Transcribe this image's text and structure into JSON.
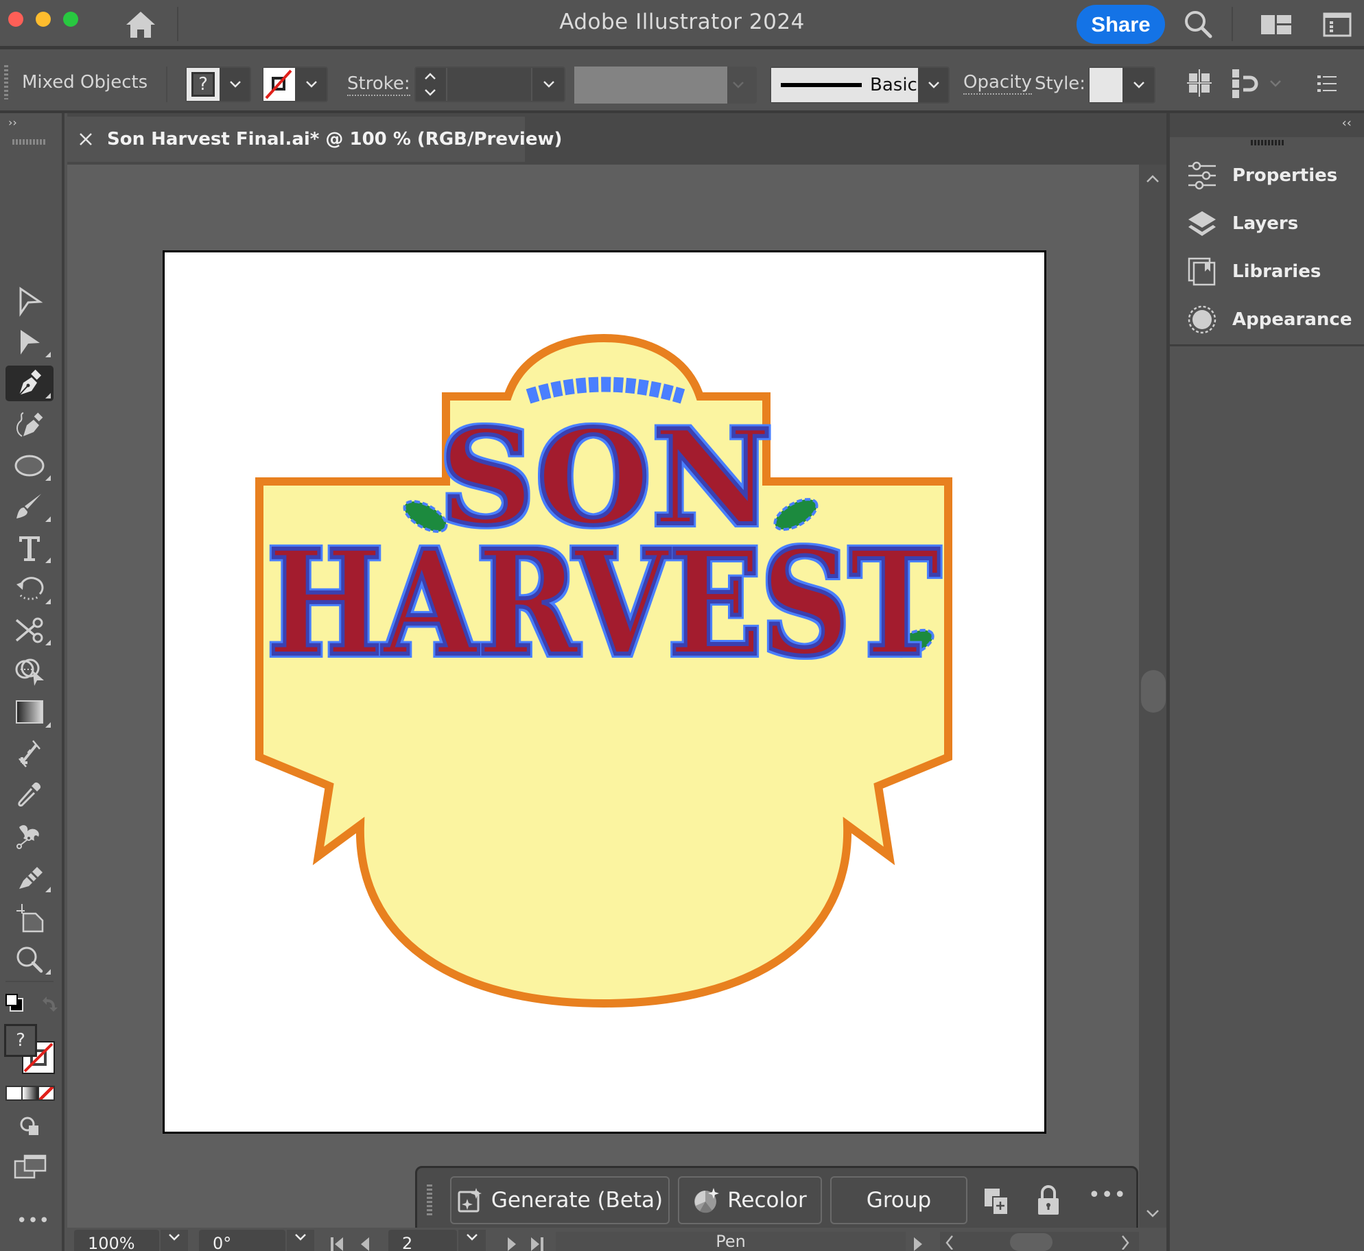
{
  "window": {
    "app_title": "Adobe Illustrator 2024",
    "share_label": "Share",
    "traffic_colors": {
      "close": "#fe5f57",
      "minimize": "#febc2e",
      "maximize": "#28c840"
    }
  },
  "control_bar": {
    "selection_label": "Mixed Objects",
    "fill_state": "?",
    "stroke_label": "Stroke:",
    "stroke_weight": "",
    "brush_label": "Basic",
    "opacity_label": "Opacity",
    "style_label": "Style:"
  },
  "document": {
    "tab_title": "Son Harvest Final.ai* @ 100 % (RGB/Preview)",
    "artwork": {
      "title_line1": "SON",
      "title_line2": "HARVEST",
      "colors": {
        "badge_fill": "#fbf4a0",
        "badge_stroke": "#e8801f",
        "letter_fill": "#a31c2e",
        "letter_outline": "#3a3fb0",
        "leaf": "#1c8a3e",
        "selection": "#4a7fff"
      }
    }
  },
  "tools": [
    {
      "name": "selection-tool",
      "label": "Selection"
    },
    {
      "name": "direct-selection-tool",
      "label": "Direct Selection"
    },
    {
      "name": "pen-tool",
      "label": "Pen",
      "active": true
    },
    {
      "name": "curvature-tool",
      "label": "Curvature"
    },
    {
      "name": "ellipse-tool",
      "label": "Ellipse"
    },
    {
      "name": "paintbrush-tool",
      "label": "Paintbrush"
    },
    {
      "name": "type-tool",
      "label": "Type"
    },
    {
      "name": "rotate-tool",
      "label": "Rotate"
    },
    {
      "name": "scissors-tool",
      "label": "Scissors"
    },
    {
      "name": "shape-builder-tool",
      "label": "Shape Builder"
    },
    {
      "name": "gradient-tool",
      "label": "Gradient"
    },
    {
      "name": "blend-tool",
      "label": "Blend"
    },
    {
      "name": "eyedropper-tool",
      "label": "Eyedropper"
    },
    {
      "name": "puppet-warp-tool",
      "label": "Puppet Warp"
    },
    {
      "name": "shaper-tool",
      "label": "Shaper"
    },
    {
      "name": "artboard-tool",
      "label": "Artboard"
    },
    {
      "name": "zoom-tool",
      "label": "Zoom"
    }
  ],
  "toolbar_extra": {
    "fill_state": "?",
    "more_label": "•••"
  },
  "right_panel": {
    "items": [
      {
        "label": "Properties"
      },
      {
        "label": "Layers"
      },
      {
        "label": "Libraries"
      },
      {
        "label": "Appearance"
      }
    ]
  },
  "task_bar": {
    "generate_label": "Generate (Beta)",
    "recolor_label": "Recolor",
    "group_label": "Group",
    "more_label": "•••"
  },
  "status_bar": {
    "zoom": "100%",
    "rotation": "0°",
    "artboard_number": "2",
    "current_tool": "Pen"
  }
}
